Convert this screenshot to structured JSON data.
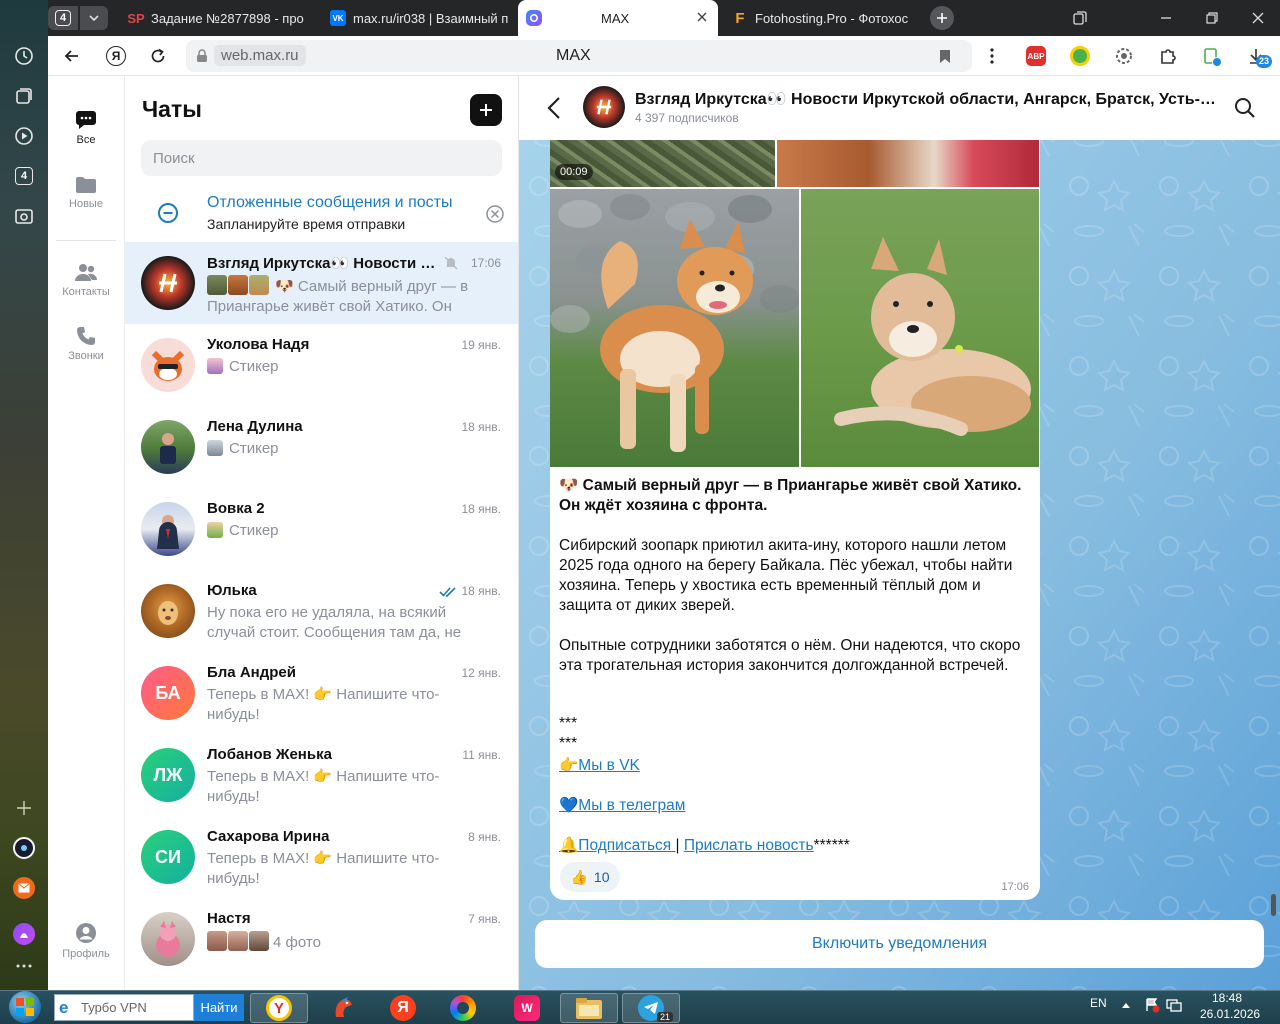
{
  "browser": {
    "tab_count": "4",
    "tabs": [
      {
        "title": "Задание №2877898 - про",
        "favicon": "SP",
        "color": "#e04545"
      },
      {
        "title": "max.ru/ir038 | Взаимный п",
        "favicon": "VK",
        "color": "#0077ff"
      },
      {
        "title": "MAX",
        "favicon": "max-icon",
        "color": "#5b4cf0"
      },
      {
        "title": "Fotohosting.Pro - Фотохос",
        "favicon": "F",
        "color": "#f5a623"
      }
    ],
    "address_host": "web.max.ru",
    "address_title": "MAX",
    "downloads_badge": "23"
  },
  "nav": {
    "items": [
      {
        "label": "Все",
        "icon": "chat-bubble-icon"
      },
      {
        "label": "Новые",
        "icon": "folder-icon"
      },
      {
        "label": "Контакты",
        "icon": "contacts-icon"
      },
      {
        "label": "Звонки",
        "icon": "phone-icon"
      },
      {
        "label": "Профиль",
        "icon": "profile-icon"
      }
    ]
  },
  "chats": {
    "title": "Чаты",
    "search_placeholder": "Поиск",
    "deferred": {
      "title": "Отложенные сообщения и посты",
      "subtitle": "Запланируйте время отправки"
    },
    "list": [
      {
        "name": "Взгляд Иркутска👀 Новости Иркутской области, Ангарск, Братск, Усть-Илимск",
        "time": "17:06",
        "preview": "🐶 Самый верный друг — в Приангарье живёт свой Хатико. Он ждёт хозяина с фронта.",
        "muted": true
      },
      {
        "name": "Уколова Надя",
        "time": "19 янв.",
        "preview": "Стикер"
      },
      {
        "name": "Лена Дулина",
        "time": "18 янв.",
        "preview": "Стикер"
      },
      {
        "name": "Вовка 2",
        "time": "18 янв.",
        "preview": "Стикер"
      },
      {
        "name": "Юлька",
        "time": "18 янв.",
        "preview": "Ну пока его не удаляла, на всякий случай стоит. Сообщения там да, не приходят",
        "read": true
      },
      {
        "name": "Бла Андрей",
        "time": "12 янв.",
        "preview": "Теперь в MAX! 👉 Напишите что-нибудь!",
        "initials": "БА"
      },
      {
        "name": "Лобанов Женька",
        "time": "11 янв.",
        "preview": "Теперь в MAX! 👉 Напишите что-нибудь!",
        "initials": "ЛЖ"
      },
      {
        "name": "Сахарова Ирина",
        "time": "8 янв.",
        "preview": "Теперь в MAX! 👉 Напишите что-нибудь!",
        "initials": "СИ"
      },
      {
        "name": "Настя",
        "time": "7 янв.",
        "preview": "4 фото"
      }
    ]
  },
  "channel": {
    "title": "Взгляд Иркутска👀 Новости Иркутской области, Ангарск, Братск, Усть-Илимск",
    "subscribers": "4 397 подписчиков",
    "video_duration": "00:09",
    "post": {
      "headline": "🐶 Самый верный друг — в Приангарье живёт свой Хатико. Он ждёт хозяина с фронта.",
      "para1": "Сибирский зоопарк приютил акита-ину, которого нашли летом 2025 года одного на берегу Байкала. Пёс убежал, чтобы найти хозяина. Теперь у хвостика есть временный тёплый дом и защита от диких зверей.",
      "para2": "Опытные сотрудники заботятся о нём. Они надеются, что скоро эта трогательная история закончится долгожданной встречей.",
      "sep1": "***",
      "sep2": "***",
      "link_vk": "👉Мы в VK",
      "link_tg": "💙Мы в телеграм ",
      "link_subscribe": "🔔Подписаться ",
      "divider": " | ",
      "link_news": "Прислать новость",
      "stars": "******",
      "reaction_emoji": "👍",
      "reaction_count": "10",
      "time": "17:06"
    },
    "notify_button": "Включить уведомления"
  },
  "taskbar": {
    "search_placeholder": "Турбо VPN",
    "search_button": "Найти",
    "telegram_badge": "21",
    "lang": "EN",
    "time": "18:48",
    "date": "26.01.2026"
  }
}
